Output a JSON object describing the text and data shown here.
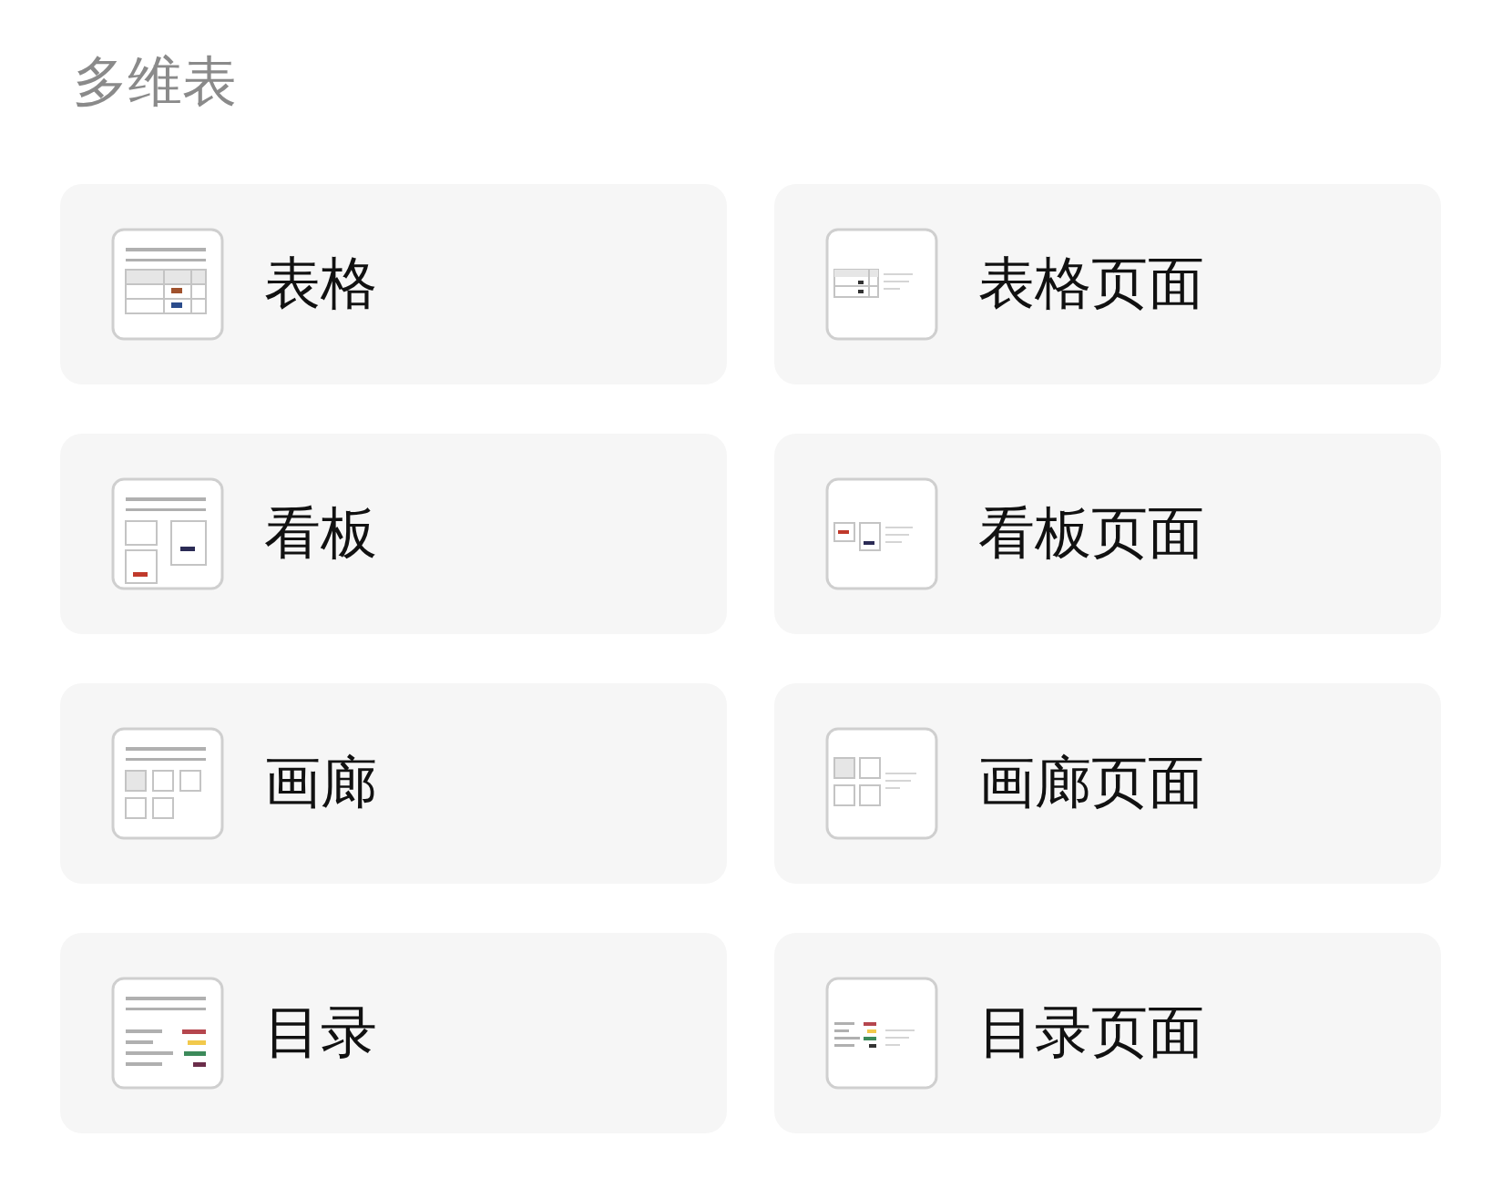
{
  "section_title": "多维表",
  "items": [
    {
      "label": "表格",
      "kind": "table"
    },
    {
      "label": "表格页面",
      "kind": "table-page"
    },
    {
      "label": "看板",
      "kind": "kanban"
    },
    {
      "label": "看板页面",
      "kind": "kanban-page"
    },
    {
      "label": "画廊",
      "kind": "gallery"
    },
    {
      "label": "画廊页面",
      "kind": "gallery-page"
    },
    {
      "label": "目录",
      "kind": "catalog"
    },
    {
      "label": "目录页面",
      "kind": "catalog-page"
    }
  ]
}
